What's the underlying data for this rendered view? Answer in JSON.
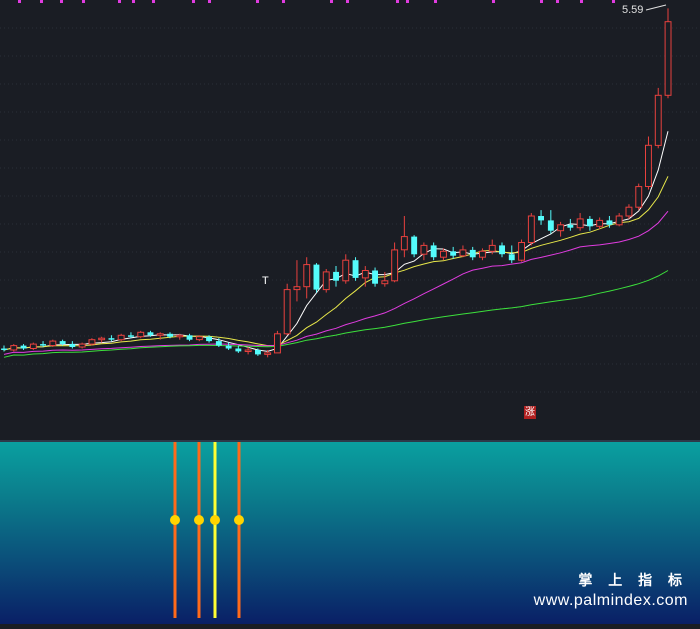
{
  "price_high_label": "5.59",
  "marker_T": "T",
  "zhang_label": "涨",
  "watermark": {
    "cn_text": "掌 上 指 标",
    "url": "www.palmindex.com"
  },
  "colors": {
    "up": "#e8413e",
    "down": "#54fcfc",
    "ma_white": "#ffffff",
    "ma_yellow": "#e8e84a",
    "ma_magenta": "#e03ce0",
    "ma_green": "#3ce03c",
    "signal_orange": "#ff6a1a",
    "signal_yellow": "#ffff33",
    "signal_dot": "#ffd400",
    "top_ticks": "#e03ce0"
  },
  "chart_data": {
    "type": "candlestick",
    "title": "",
    "candles_ohlc": [
      [
        3.28,
        3.3,
        3.26,
        3.27
      ],
      [
        3.27,
        3.31,
        3.26,
        3.3
      ],
      [
        3.3,
        3.31,
        3.27,
        3.28
      ],
      [
        3.28,
        3.32,
        3.27,
        3.31
      ],
      [
        3.31,
        3.33,
        3.29,
        3.3
      ],
      [
        3.3,
        3.34,
        3.29,
        3.33
      ],
      [
        3.33,
        3.34,
        3.3,
        3.31
      ],
      [
        3.31,
        3.33,
        3.28,
        3.29
      ],
      [
        3.29,
        3.32,
        3.28,
        3.31
      ],
      [
        3.31,
        3.35,
        3.3,
        3.34
      ],
      [
        3.34,
        3.36,
        3.32,
        3.35
      ],
      [
        3.35,
        3.37,
        3.33,
        3.34
      ],
      [
        3.34,
        3.38,
        3.33,
        3.37
      ],
      [
        3.37,
        3.39,
        3.35,
        3.36
      ],
      [
        3.36,
        3.4,
        3.35,
        3.39
      ],
      [
        3.39,
        3.4,
        3.36,
        3.37
      ],
      [
        3.37,
        3.39,
        3.34,
        3.38
      ],
      [
        3.38,
        3.39,
        3.35,
        3.36
      ],
      [
        3.36,
        3.38,
        3.34,
        3.37
      ],
      [
        3.37,
        3.38,
        3.33,
        3.34
      ],
      [
        3.34,
        3.37,
        3.33,
        3.36
      ],
      [
        3.36,
        3.37,
        3.32,
        3.33
      ],
      [
        3.33,
        3.35,
        3.29,
        3.3
      ],
      [
        3.3,
        3.32,
        3.27,
        3.28
      ],
      [
        3.28,
        3.3,
        3.25,
        3.26
      ],
      [
        3.26,
        3.29,
        3.24,
        3.27
      ],
      [
        3.27,
        3.28,
        3.23,
        3.24
      ],
      [
        3.24,
        3.27,
        3.22,
        3.25
      ],
      [
        3.25,
        3.4,
        3.25,
        3.38
      ],
      [
        3.38,
        3.72,
        3.37,
        3.68
      ],
      [
        3.68,
        3.88,
        3.6,
        3.7
      ],
      [
        3.7,
        3.9,
        3.62,
        3.85
      ],
      [
        3.85,
        3.86,
        3.66,
        3.68
      ],
      [
        3.68,
        3.82,
        3.66,
        3.8
      ],
      [
        3.8,
        3.84,
        3.7,
        3.74
      ],
      [
        3.74,
        3.92,
        3.72,
        3.88
      ],
      [
        3.88,
        3.9,
        3.74,
        3.76
      ],
      [
        3.76,
        3.84,
        3.7,
        3.81
      ],
      [
        3.81,
        3.83,
        3.7,
        3.72
      ],
      [
        3.72,
        3.8,
        3.7,
        3.74
      ],
      [
        3.74,
        4.0,
        3.73,
        3.95
      ],
      [
        3.95,
        4.18,
        3.9,
        4.04
      ],
      [
        4.04,
        4.05,
        3.9,
        3.92
      ],
      [
        3.92,
        4.0,
        3.88,
        3.98
      ],
      [
        3.98,
        4.0,
        3.88,
        3.9
      ],
      [
        3.9,
        3.96,
        3.88,
        3.94
      ],
      [
        3.94,
        3.97,
        3.89,
        3.91
      ],
      [
        3.91,
        3.98,
        3.9,
        3.95
      ],
      [
        3.95,
        3.97,
        3.88,
        3.9
      ],
      [
        3.9,
        3.96,
        3.88,
        3.94
      ],
      [
        3.94,
        4.02,
        3.92,
        3.98
      ],
      [
        3.98,
        4.0,
        3.9,
        3.92
      ],
      [
        3.92,
        3.98,
        3.86,
        3.88
      ],
      [
        3.88,
        4.02,
        3.87,
        4.0
      ],
      [
        4.0,
        4.2,
        3.98,
        4.18
      ],
      [
        4.18,
        4.22,
        4.12,
        4.15
      ],
      [
        4.15,
        4.22,
        4.06,
        4.08
      ],
      [
        4.08,
        4.14,
        4.04,
        4.12
      ],
      [
        4.12,
        4.16,
        4.08,
        4.1
      ],
      [
        4.1,
        4.2,
        4.08,
        4.16
      ],
      [
        4.16,
        4.18,
        4.08,
        4.11
      ],
      [
        4.11,
        4.17,
        4.09,
        4.15
      ],
      [
        4.15,
        4.18,
        4.1,
        4.12
      ],
      [
        4.12,
        4.2,
        4.11,
        4.18
      ],
      [
        4.18,
        4.26,
        4.16,
        4.24
      ],
      [
        4.24,
        4.4,
        4.22,
        4.38
      ],
      [
        4.38,
        4.72,
        4.36,
        4.66
      ],
      [
        4.66,
        5.05,
        4.64,
        5.0
      ],
      [
        5.0,
        5.59,
        4.98,
        5.5
      ]
    ],
    "ma": [
      {
        "values": []
      },
      {
        "values": []
      },
      {
        "values": []
      },
      {
        "values": []
      }
    ],
    "indicator_signals": [
      {
        "index": 22,
        "type": "orange"
      },
      {
        "index": 25,
        "type": "orange"
      },
      {
        "index": 27,
        "type": "yellow"
      },
      {
        "index": 30,
        "type": "orange"
      }
    ],
    "top_tick_count": 14,
    "ylim": [
      3.1,
      5.62
    ]
  }
}
